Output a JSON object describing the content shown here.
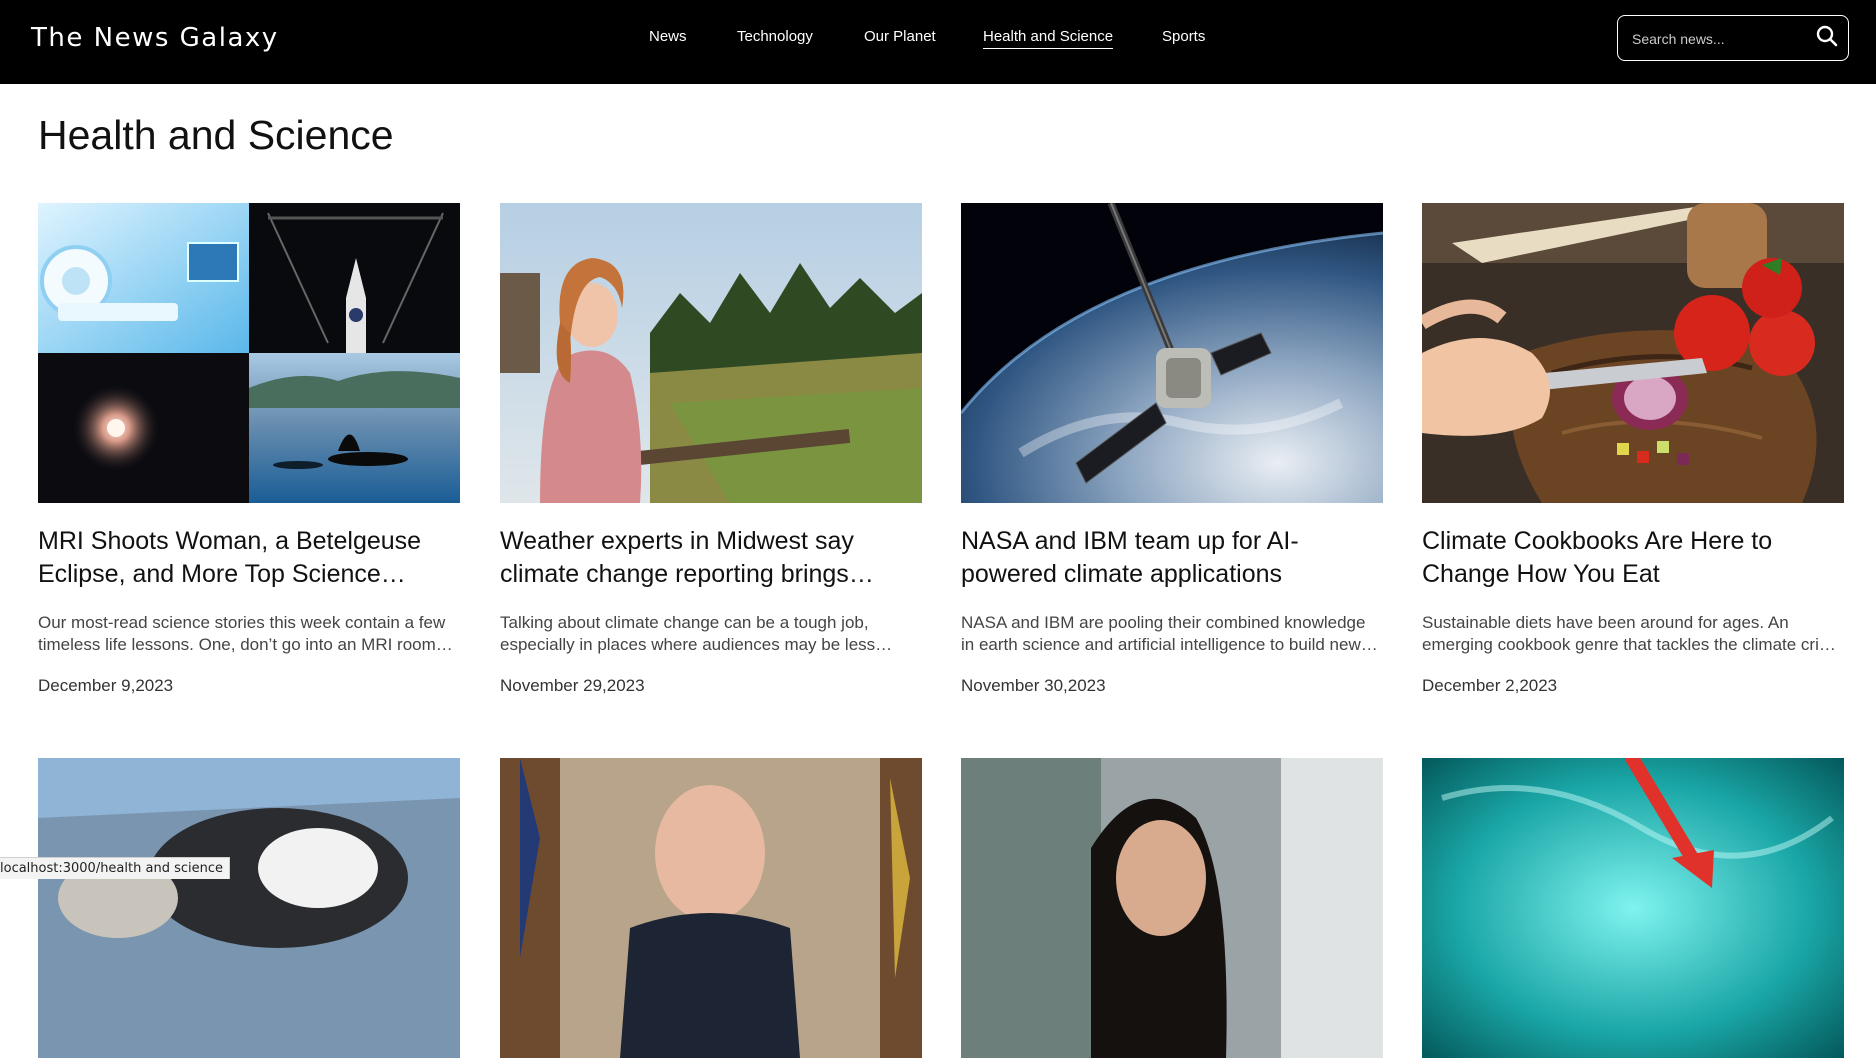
{
  "header": {
    "brand": "The News Galaxy",
    "nav": [
      {
        "label": "News"
      },
      {
        "label": "Technology"
      },
      {
        "label": "Our Planet"
      },
      {
        "label": "Health and Science",
        "active": true
      },
      {
        "label": "Sports"
      }
    ],
    "search": {
      "placeholder": "Search news...",
      "value": "",
      "icon": "search-icon"
    }
  },
  "page": {
    "title": "Health and Science"
  },
  "articles": [
    {
      "title": "MRI Shoots Woman, a Betelgeuse Eclipse, and More Top Science Stories",
      "description": "Our most-read science stories this week contain a few timeless life lessons. One, don’t go into an MRI room with a concealed weapon.",
      "date": "December 9,2023",
      "image": "science collage: MRI scanner, rocket, star, orca"
    },
    {
      "title": "Weather experts in Midwest say climate change reporting brings backlash",
      "description": "Talking about climate change can be a tough job, especially in places where audiences may be less receptive.",
      "date": "November 29,2023",
      "image": "woman on a porch overlooking a field"
    },
    {
      "title": "NASA and IBM team up for AI-powered climate applications",
      "description": "NASA and IBM are pooling their combined knowledge in earth science and artificial intelligence to build new models.",
      "date": "November 30,2023",
      "image": "spacecraft above earth"
    },
    {
      "title": "Climate Cookbooks Are Here to Change How You Eat",
      "description": "Sustainable diets have been around for ages. An emerging cookbook genre that tackles the climate crisis is new.",
      "date": "December 2,2023",
      "image": "hands chopping an onion with tomatoes"
    }
  ],
  "second_row_images": [
    "penguin on a rock by the sea",
    "man speaking in front of flags",
    "woman with dark hair",
    "teal solar surface with red arrow"
  ],
  "status_bar": {
    "url": "localhost:3000/health and science"
  },
  "colors": {
    "header_bg": "#000000",
    "text": "#111111",
    "muted": "#444444"
  }
}
